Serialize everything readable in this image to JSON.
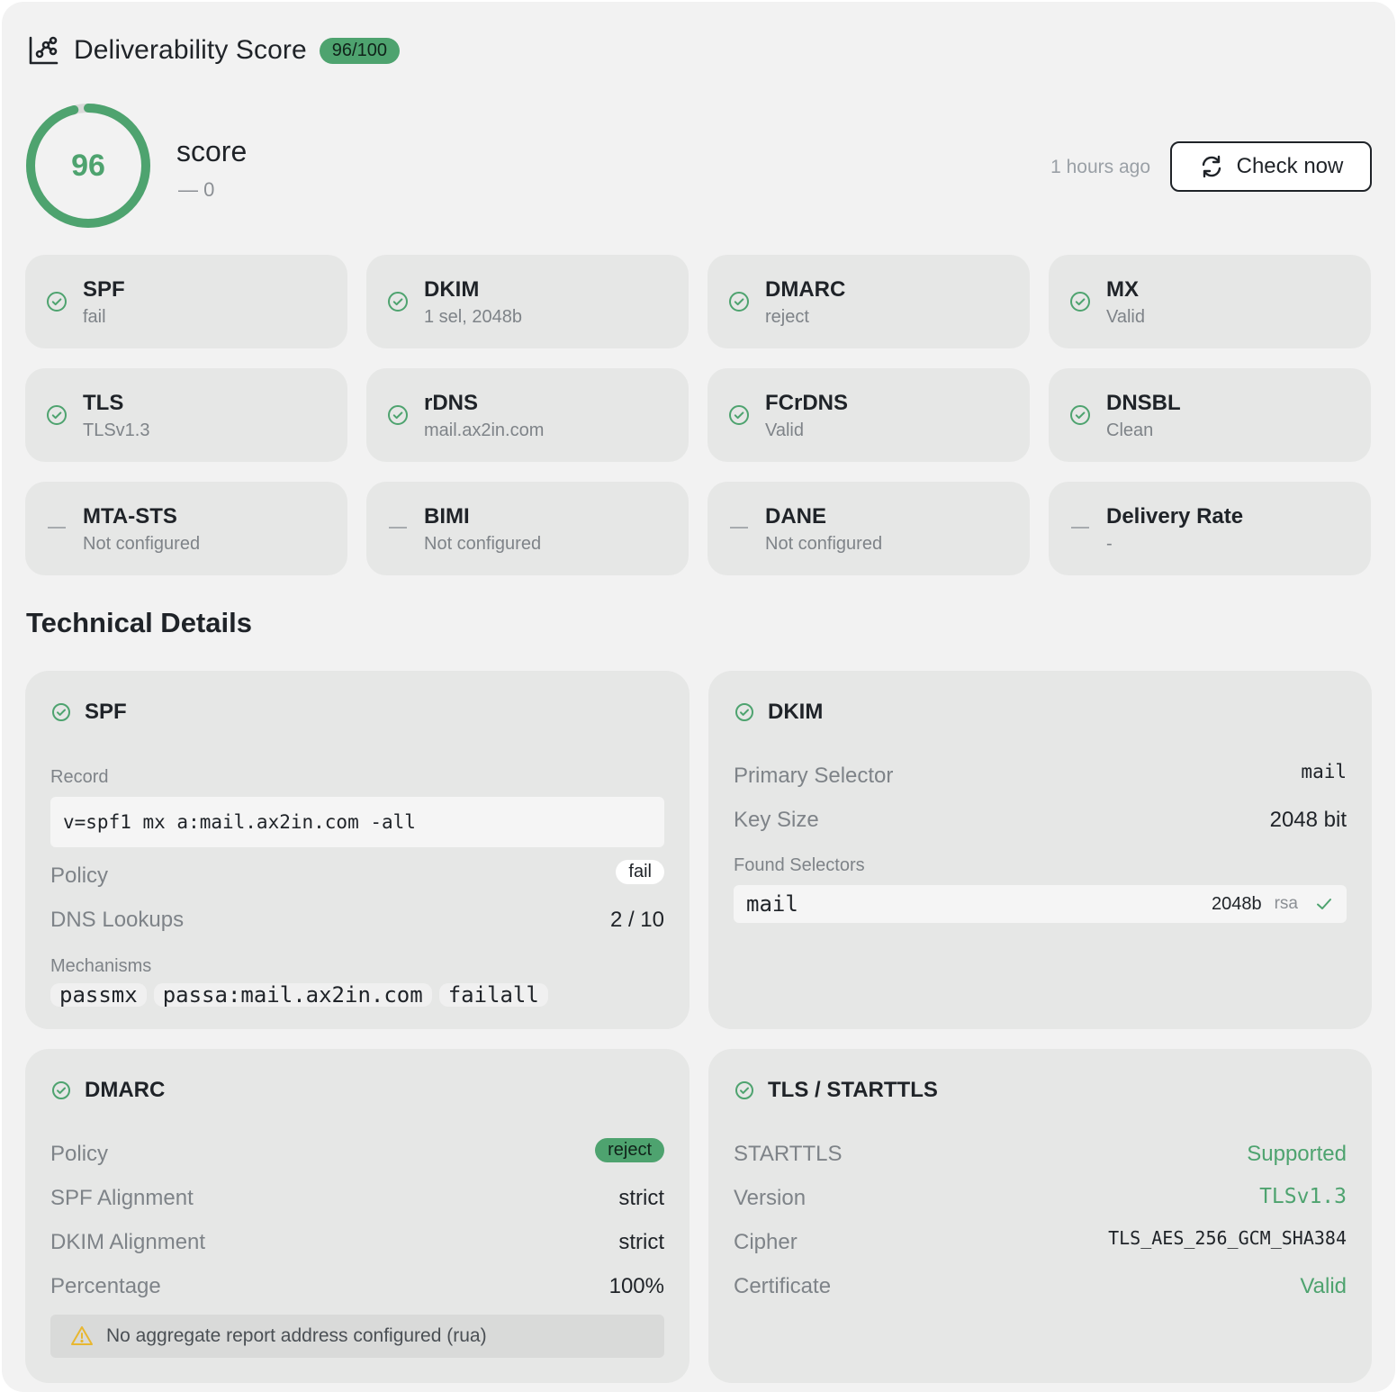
{
  "header": {
    "title": "Deliverability Score",
    "badge": "96/100"
  },
  "score": {
    "value": "96",
    "fraction": 0.96,
    "label": "score",
    "delta": "— 0"
  },
  "updated": "1 hours ago",
  "check_button": "Check now",
  "colors": {
    "accent": "#4ea36f",
    "warning": "#e8b730",
    "muted": "#7e8388"
  },
  "checks": [
    {
      "name": "SPF",
      "value": "fail",
      "state": "ok"
    },
    {
      "name": "DKIM",
      "value": "1 sel, 2048b",
      "state": "ok"
    },
    {
      "name": "DMARC",
      "value": "reject",
      "state": "ok"
    },
    {
      "name": "MX",
      "value": "Valid",
      "state": "ok"
    },
    {
      "name": "TLS",
      "value": "TLSv1.3",
      "state": "ok"
    },
    {
      "name": "rDNS",
      "value": "mail.ax2in.com",
      "state": "ok"
    },
    {
      "name": "FCrDNS",
      "value": "Valid",
      "state": "ok"
    },
    {
      "name": "DNSBL",
      "value": "Clean",
      "state": "ok"
    },
    {
      "name": "MTA-STS",
      "value": "Not configured",
      "state": "none"
    },
    {
      "name": "BIMI",
      "value": "Not configured",
      "state": "none"
    },
    {
      "name": "DANE",
      "value": "Not configured",
      "state": "none"
    },
    {
      "name": "Delivery Rate",
      "value": "-",
      "state": "none"
    }
  ],
  "technical": {
    "title": "Technical Details",
    "spf": {
      "title": "SPF",
      "record_label": "Record",
      "record": "v=spf1 mx a:mail.ax2in.com -all",
      "policy_label": "Policy",
      "policy": "fail",
      "lookups_label": "DNS Lookups",
      "lookups": "2 / 10",
      "mechanisms_label": "Mechanisms",
      "mechanisms": [
        "passmx",
        "passa:mail.ax2in.com",
        "failall"
      ]
    },
    "dkim": {
      "title": "DKIM",
      "primary_label": "Primary Selector",
      "primary": "mail",
      "keysize_label": "Key Size",
      "keysize": "2048 bit",
      "found_label": "Found Selectors",
      "selectors": [
        {
          "name": "mail",
          "bits": "2048b",
          "alg": "rsa"
        }
      ]
    },
    "dmarc": {
      "title": "DMARC",
      "policy_label": "Policy",
      "policy": "reject",
      "spf_align_label": "SPF Alignment",
      "spf_align": "strict",
      "dkim_align_label": "DKIM Alignment",
      "dkim_align": "strict",
      "pct_label": "Percentage",
      "pct": "100%",
      "warning": "No aggregate report address configured (rua)"
    },
    "tls": {
      "title": "TLS / STARTTLS",
      "starttls_label": "STARTTLS",
      "starttls": "Supported",
      "version_label": "Version",
      "version": "TLSv1.3",
      "cipher_label": "Cipher",
      "cipher": "TLS_AES_256_GCM_SHA384",
      "cert_label": "Certificate",
      "cert": "Valid"
    }
  }
}
